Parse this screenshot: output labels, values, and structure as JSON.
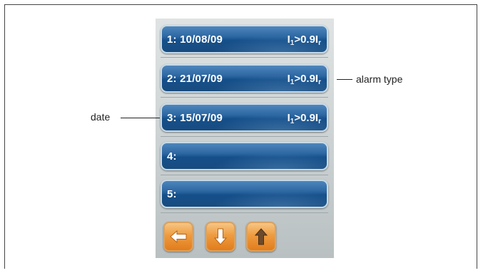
{
  "entries": [
    {
      "date": "1: 10/08/09",
      "alarm_main": "I",
      "alarm_sub1": "1",
      "alarm_mid": ">0.9I",
      "alarm_sub2": "r"
    },
    {
      "date": "2: 21/07/09",
      "alarm_main": "I",
      "alarm_sub1": "1",
      "alarm_mid": ">0.9I",
      "alarm_sub2": "r"
    },
    {
      "date": "3: 15/07/09",
      "alarm_main": "I",
      "alarm_sub1": "1",
      "alarm_mid": ">0.9I",
      "alarm_sub2": "r"
    },
    {
      "date": "4:",
      "alarm_main": "",
      "alarm_sub1": "",
      "alarm_mid": "",
      "alarm_sub2": ""
    },
    {
      "date": "5:",
      "alarm_main": "",
      "alarm_sub1": "",
      "alarm_mid": "",
      "alarm_sub2": ""
    }
  ],
  "callouts": {
    "alarm_type": "alarm type",
    "date": "date"
  },
  "nav": {
    "back_icon": "arrow-left-icon",
    "down_icon": "arrow-down-icon",
    "up_icon": "arrow-up-icon"
  },
  "colors": {
    "entry_blue": "#1f5a94",
    "button_orange": "#ee9b3f"
  }
}
